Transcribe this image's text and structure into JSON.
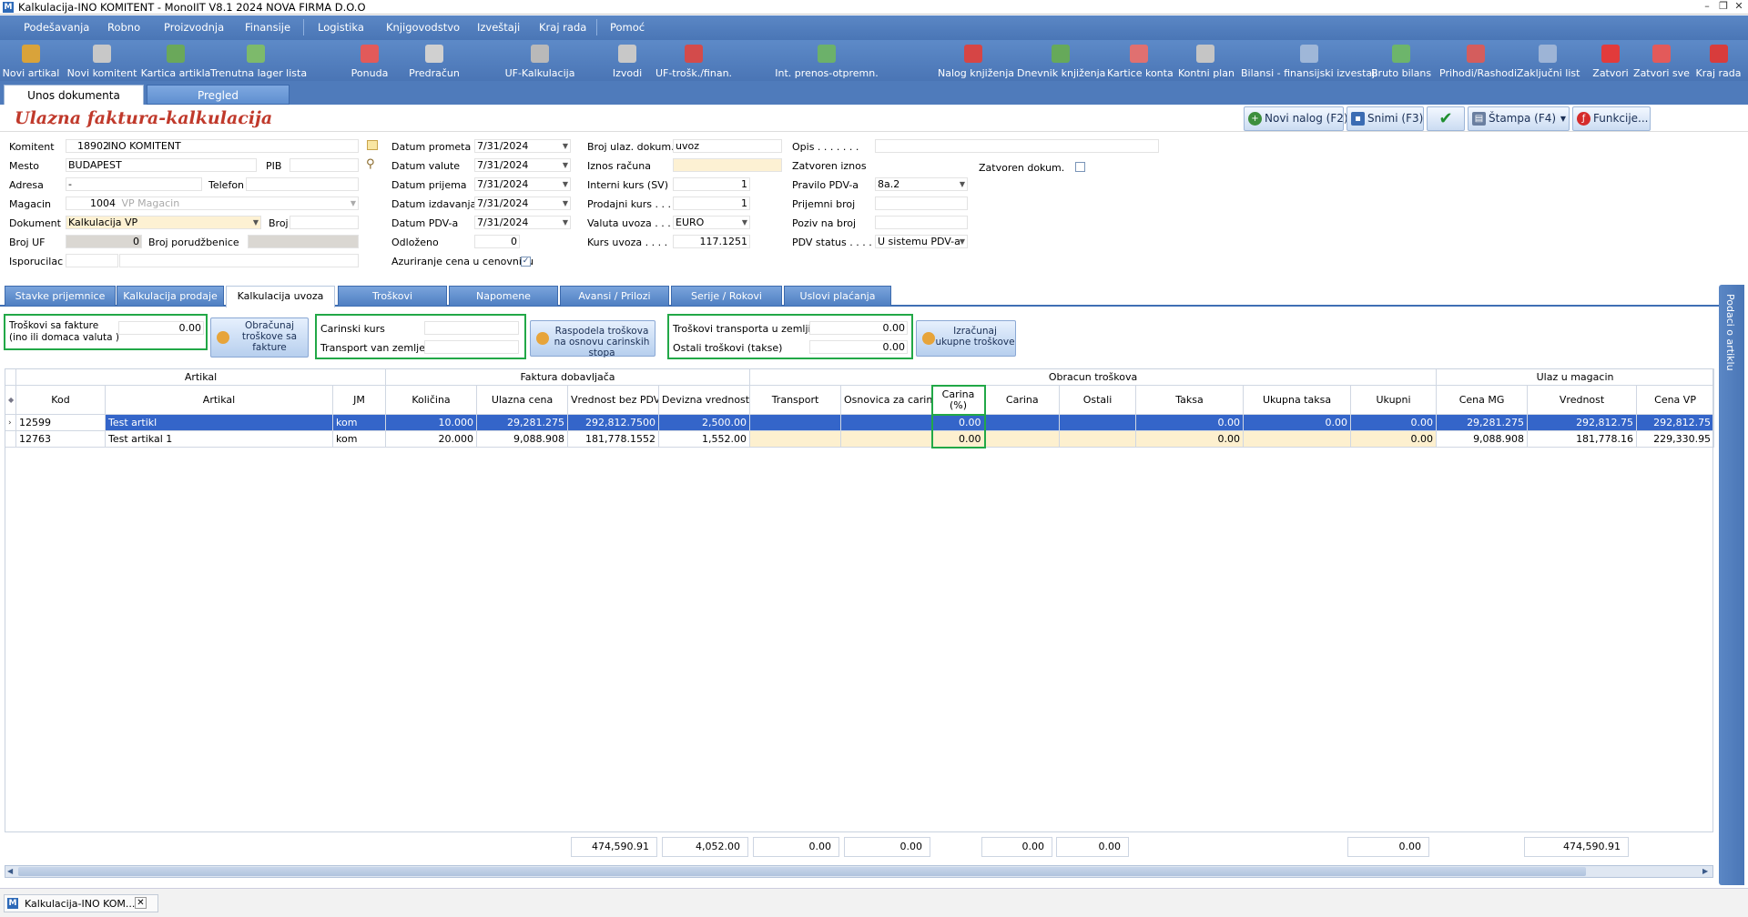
{
  "window": {
    "title": "Kalkulacija-INO KOMITENT - MonoIIT V8.1 2024 NOVA FIRMA D.O.O"
  },
  "menu": [
    "Podešavanja",
    "Robno",
    "Proizvodnja",
    "Finansije",
    "Logistika",
    "Knjigovodstvo",
    "Izveštaji",
    "Kraj rada",
    "Pomoć"
  ],
  "toolbar": [
    {
      "label": "Novi artikal",
      "icon": "new-article-icon",
      "color": "#d9a33a"
    },
    {
      "label": "Novi komitent",
      "icon": "new-client-icon",
      "color": "#c8c8c8"
    },
    {
      "label": "Kartica artikla",
      "icon": "article-card-icon",
      "color": "#6aa85a"
    },
    {
      "label": "Trenutna lager lista",
      "icon": "stock-list-icon",
      "color": "#7dba6b"
    },
    {
      "label": "Ponuda",
      "icon": "offer-icon",
      "color": "#e25a5a"
    },
    {
      "label": "Predračun",
      "icon": "proforma-icon",
      "color": "#d0d0d0"
    },
    {
      "label": "UF-Kalkulacija",
      "icon": "calculation-icon",
      "color": "#b9b9b9"
    },
    {
      "label": "Izvodi",
      "icon": "statements-icon",
      "color": "#c8c8c8"
    },
    {
      "label": "UF-trošk./finan.",
      "icon": "cost-icon",
      "color": "#d34b4b"
    },
    {
      "label": "Int. prenos-otpremn.",
      "icon": "transfer-icon",
      "color": "#6cb16a"
    },
    {
      "label": "Nalog knjiženja",
      "icon": "journal-icon",
      "color": "#d64545"
    },
    {
      "label": "Dnevnik knjiženja",
      "icon": "daybook-icon",
      "color": "#66a95a"
    },
    {
      "label": "Kartice konta",
      "icon": "account-cards-icon",
      "color": "#e07070"
    },
    {
      "label": "Kontni plan",
      "icon": "chart-of-accounts-icon",
      "color": "#c5c5c5"
    },
    {
      "label": "Bilansi - finansijski izvestaji",
      "icon": "balance-icon",
      "color": "#9fb7d8"
    },
    {
      "label": "Bruto bilans",
      "icon": "gross-balance-icon",
      "color": "#6db56b"
    },
    {
      "label": "Prihodi/Rashodi",
      "icon": "income-expense-icon",
      "color": "#d45d5d"
    },
    {
      "label": "Zaključni list",
      "icon": "closing-sheet-icon",
      "color": "#9db4d6"
    },
    {
      "label": "Zatvori",
      "icon": "close-icon",
      "color": "#e23b3b"
    },
    {
      "label": "Zatvori sve",
      "icon": "close-all-icon",
      "color": "#e35a5a"
    },
    {
      "label": "Kraj rada",
      "icon": "power-icon",
      "color": "#d83c3c"
    }
  ],
  "tabs": {
    "entry": "Unos dokumenta",
    "review": "Pregled"
  },
  "header": {
    "title": "Ulazna faktura-kalkulacija",
    "buttons": {
      "new": "Novi nalog (F2)",
      "save": "Snimi (F3)",
      "print": "Štampa (F4)",
      "functions": "Funkcije..."
    }
  },
  "form": {
    "komitent_label": "Komitent",
    "komitent_code": "18902",
    "komitent_name": "INO KOMITENT",
    "mesto_label": "Mesto",
    "mesto": "BUDAPEST",
    "pib_label": "PIB",
    "pib": "",
    "adresa_label": "Adresa",
    "adresa": "-",
    "telefon_label": "Telefon",
    "telefon": "",
    "magacin_label": "Magacin",
    "magacin_code": "1004",
    "magacin_name": "VP Magacin",
    "dokument_label": "Dokument",
    "dokument": "Kalkulacija VP",
    "broj_label": "Broj",
    "broj": "",
    "brojuf_label": "Broj UF",
    "brojuf": "0",
    "brojporud_label": "Broj porudžbenice",
    "brojporud": "",
    "isporucilac_label": "Isporucilac",
    "isporucilac": "",
    "datum_prometa_label": "Datum prometa",
    "datum_prometa": "7/31/2024",
    "datum_valute_label": "Datum valute",
    "datum_valute": "7/31/2024",
    "datum_prijema_label": "Datum prijema",
    "datum_prijema": "7/31/2024",
    "datum_izdavanja_label": "Datum izdavanja",
    "datum_izdavanja": "7/31/2024",
    "datum_pdv_label": "Datum PDV-a",
    "datum_pdv": "7/31/2024",
    "odlozeno_label": "Odloženo",
    "odlozeno": "0",
    "azuriranje_label": "Azuriranje cena u cenovniku",
    "broj_ulaz_label": "Broj ulaz. dokum.",
    "broj_ulaz": "uvoz",
    "iznos_racuna_label": "Iznos računa",
    "iznos_racuna": "",
    "interni_kurs_label": "Interni kurs (SV)",
    "interni_kurs": "1",
    "prodajni_kurs_label": "Prodajni kurs . . .",
    "prodajni_kurs": "1",
    "valuta_uvoza_label": "Valuta uvoza . . .",
    "valuta_uvoza": "EURO",
    "kurs_uvoza_label": "Kurs uvoza . . . .",
    "kurs_uvoza": "117.1251",
    "opis_label": "Opis . . . . . . .",
    "opis": "",
    "zatvoren_iznos_label": "Zatvoren iznos",
    "zatvoren_dokum_label": "Zatvoren dokum.",
    "pravilo_pdv_label": "Pravilo PDV-a",
    "pravilo_pdv": "8a.2",
    "prijemni_broj_label": "Prijemni broj",
    "prijemni_broj": "",
    "poziv_label": "Poziv na broj",
    "poziv": "",
    "pdv_status_label": "PDV status . . . .",
    "pdv_status": "U sistemu PDV-a"
  },
  "subtabs": [
    "Stavke prijemnice",
    "Kalkulacija prodaje",
    "Kalkulacija uvoza",
    "Troškovi",
    "Napomene",
    "Avansi / Prilozi",
    "Serije / Rokovi trajanja",
    "Uslovi plaćanja"
  ],
  "costs": {
    "troskovi_fakture_label": "Troškovi sa fakture",
    "troskovi_fakture_sub": "(ino ili domaca valuta )",
    "troskovi_fakture": "0.00",
    "obracunaj_btn": "Obračunaj troškove sa fakture",
    "carinski_kurs_label": "Carinski kurs",
    "carinski_kurs": "",
    "transport_van_label": "Transport van zemlje",
    "transport_van": "",
    "raspodela_btn": "Raspodela troškova na osnovu carinskih stopa",
    "transport_u_label": "Troškovi transporta u zemlji",
    "transport_u": "0.00",
    "ostali_label": "Ostali troškovi (takse)",
    "ostali": "0.00",
    "izracunaj_btn": "Izračunaj ukupne troškove"
  },
  "grid": {
    "groups": {
      "artikal": "Artikal",
      "faktura": "Faktura dobavljača",
      "obracun": "Obracun troškova",
      "ulaz": "Ulaz u magacin"
    },
    "columns": [
      "Kod",
      "Artikal",
      "JM",
      "Količina",
      "Ulazna cena",
      "Vrednost bez PDV-a",
      "Devizna vrednost",
      "Transport",
      "Osnovica za carinu",
      "Carina (%)",
      "Carina",
      "Ostali",
      "Taksa",
      "Ukupna taksa",
      "Ukupni",
      "Cena MG",
      "Vrednost",
      "Cena VP"
    ],
    "rows": [
      [
        "12599",
        "Test artikl",
        "kom",
        "10.000",
        "29,281.275",
        "292,812.7500",
        "2,500.00",
        "",
        "",
        "0.00",
        "",
        "",
        "0.00",
        "0.00",
        "0.00",
        "29,281.275",
        "292,812.75",
        "292,812.75"
      ],
      [
        "12763",
        "Test artikal 1",
        "kom",
        "20.000",
        "9,088.908",
        "181,778.1552",
        "1,552.00",
        "",
        "",
        "0.00",
        "",
        "",
        "0.00",
        "",
        "0.00",
        "9,088.908",
        "181,778.16",
        "229,330.95"
      ]
    ],
    "totals": {
      "vrednost": "474,590.91",
      "devizna": "4,052.00",
      "transport": "0.00",
      "osnovica": "0.00",
      "carina": "0.00",
      "ostali": "0.00",
      "ukupni": "0.00",
      "vrednost_mg": "474,590.91"
    }
  },
  "side_panel": "Podaci o artiklu",
  "taskbar": {
    "item": "Kalkulacija-INO KOM..."
  }
}
